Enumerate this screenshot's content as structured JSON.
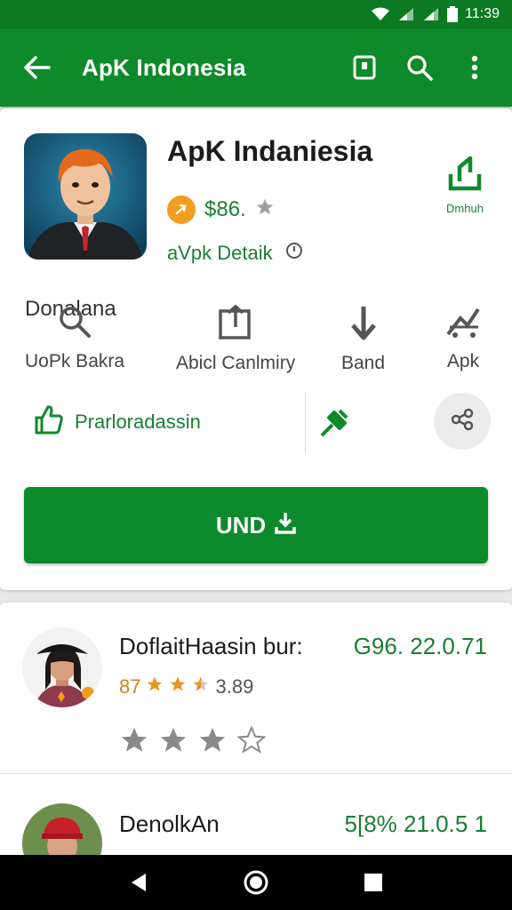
{
  "status_bar": {
    "time": "11:39"
  },
  "app_bar": {
    "title": "ApK Indonesia"
  },
  "app": {
    "name": "ApK Indaniesia",
    "rating_value": "$86.",
    "detail_label": "aVpk Detaik",
    "download_label": "Dmhuh",
    "accent_color": "#0f8a2a"
  },
  "categories": {
    "header": "Donalana",
    "items": [
      {
        "label": "UoPk Bakra"
      },
      {
        "label": "Abicl Canlmiry"
      },
      {
        "label": "Band"
      },
      {
        "label": "Apk"
      }
    ]
  },
  "actions": {
    "primary_label": "Prarloradassin"
  },
  "install": {
    "label": "UND"
  },
  "reviews": [
    {
      "name": "DoflaitHaasin bur:",
      "value": "G96. 22.0.71",
      "score": "87",
      "score_extra": "3.89",
      "rating": 3
    },
    {
      "name": "DenolkAn",
      "value": "5[8% 21.0.5 1"
    }
  ]
}
